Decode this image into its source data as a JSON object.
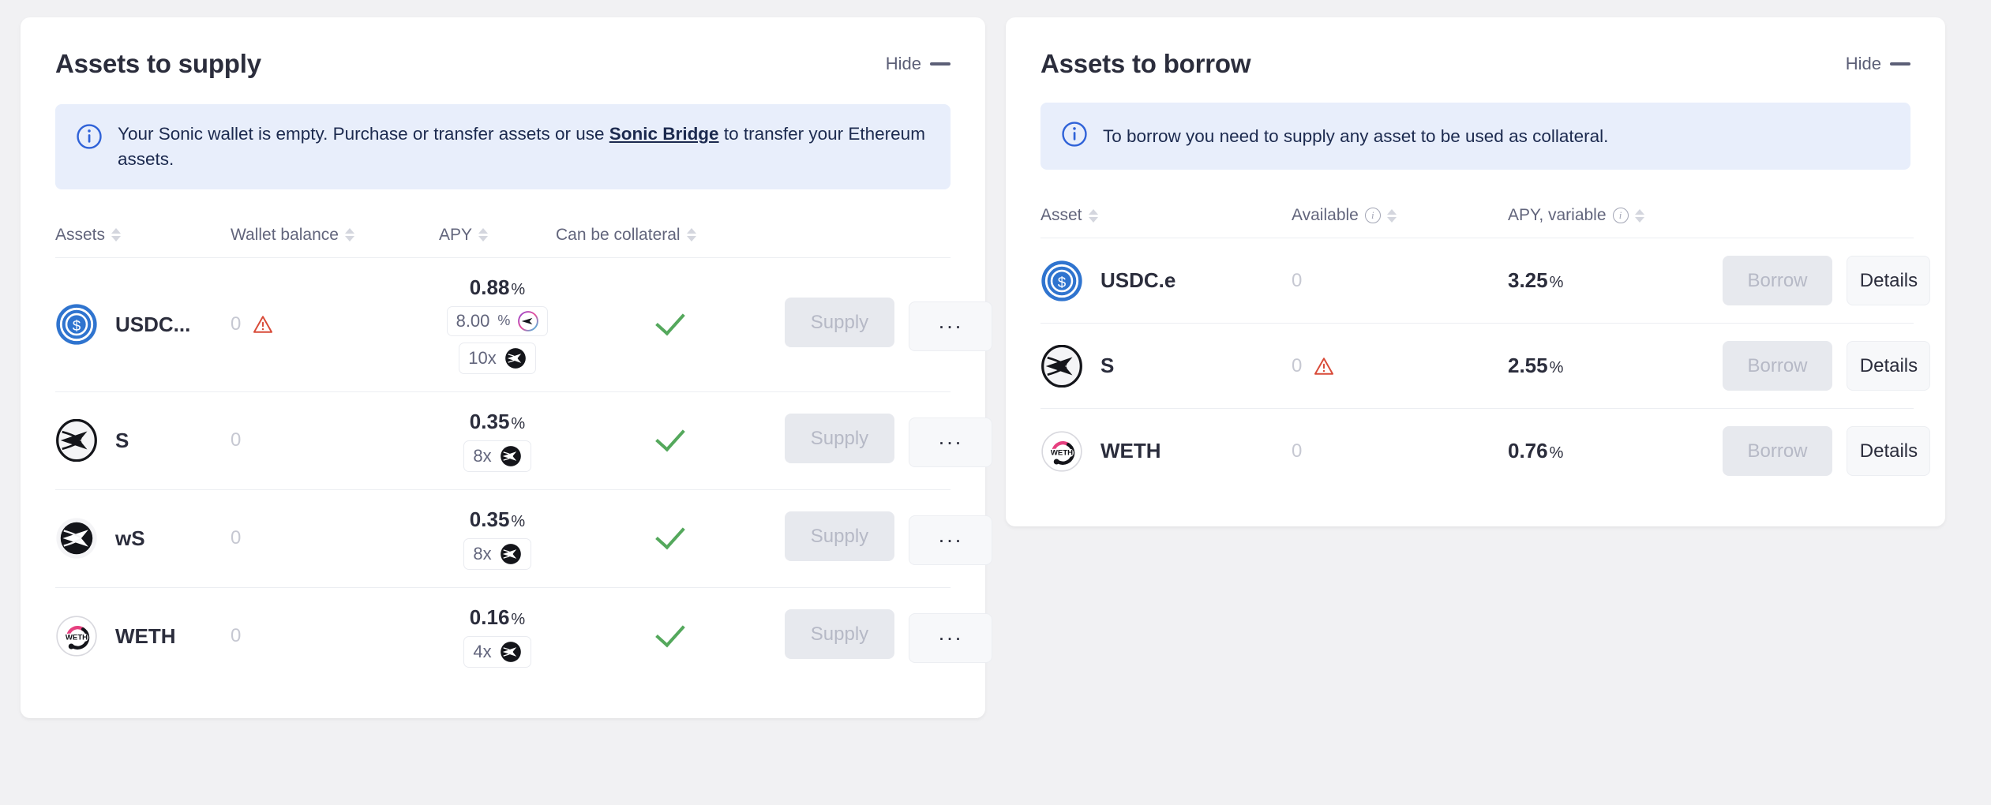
{
  "supply_panel": {
    "title": "Assets to supply",
    "hide_label": "Hide",
    "banner": {
      "text_before": "Your Sonic wallet is empty. Purchase or transfer assets or use ",
      "link": "Sonic Bridge",
      "text_after": " to transfer your Ethereum assets."
    },
    "columns": {
      "assets": "Assets",
      "wallet_balance": "Wallet balance",
      "apy": "APY",
      "can_be_collateral": "Can be collateral"
    },
    "supply_label": "Supply",
    "more_label": "...",
    "rows": [
      {
        "asset": "USDC...",
        "icon": "usdc-icon",
        "wallet_balance": "0",
        "has_warning": true,
        "apy": "0.88",
        "apy_unit": "%",
        "badges": [
          {
            "value": "8.00",
            "unit": "%",
            "icon": "sonic-points-icon"
          },
          {
            "value": "10x",
            "unit": "",
            "icon": "sonic-icon"
          }
        ],
        "collateral": true
      },
      {
        "asset": "S",
        "icon": "sonic-icon",
        "wallet_balance": "0",
        "has_warning": false,
        "apy": "0.35",
        "apy_unit": "%",
        "badges": [
          {
            "value": "8x",
            "unit": "",
            "icon": "sonic-icon"
          }
        ],
        "collateral": true
      },
      {
        "asset": "wS",
        "icon": "wrapped-sonic-icon",
        "wallet_balance": "0",
        "has_warning": false,
        "apy": "0.35",
        "apy_unit": "%",
        "badges": [
          {
            "value": "8x",
            "unit": "",
            "icon": "sonic-icon"
          }
        ],
        "collateral": true
      },
      {
        "asset": "WETH",
        "icon": "weth-icon",
        "wallet_balance": "0",
        "has_warning": false,
        "apy": "0.16",
        "apy_unit": "%",
        "badges": [
          {
            "value": "4x",
            "unit": "",
            "icon": "sonic-icon"
          }
        ],
        "collateral": true
      }
    ]
  },
  "borrow_panel": {
    "title": "Assets to borrow",
    "hide_label": "Hide",
    "banner": {
      "text": "To borrow you need to supply any asset to be used as collateral."
    },
    "columns": {
      "asset": "Asset",
      "available": "Available",
      "apy_variable": "APY, variable"
    },
    "borrow_label": "Borrow",
    "details_label": "Details",
    "rows": [
      {
        "asset": "USDC.e",
        "icon": "usdc-icon",
        "available": "0",
        "has_warning": false,
        "apy": "3.25",
        "apy_unit": "%"
      },
      {
        "asset": "S",
        "icon": "sonic-icon",
        "available": "0",
        "has_warning": true,
        "apy": "2.55",
        "apy_unit": "%"
      },
      {
        "asset": "WETH",
        "icon": "weth-icon",
        "available": "0",
        "has_warning": false,
        "apy": "0.76",
        "apy_unit": "%"
      }
    ]
  },
  "colors": {
    "page_bg": "#f1f1f3",
    "card_bg": "#ffffff",
    "banner_bg": "#e8eefb",
    "banner_text": "#1c2a4f",
    "heading": "#2b2d3c",
    "muted": "#62657c",
    "zero": "#c6c8d2",
    "check_green": "#54a85c",
    "warning_red": "#d84a38",
    "usdc_blue": "#2f74cf",
    "disabled_btn_bg": "#e7e9ee"
  }
}
